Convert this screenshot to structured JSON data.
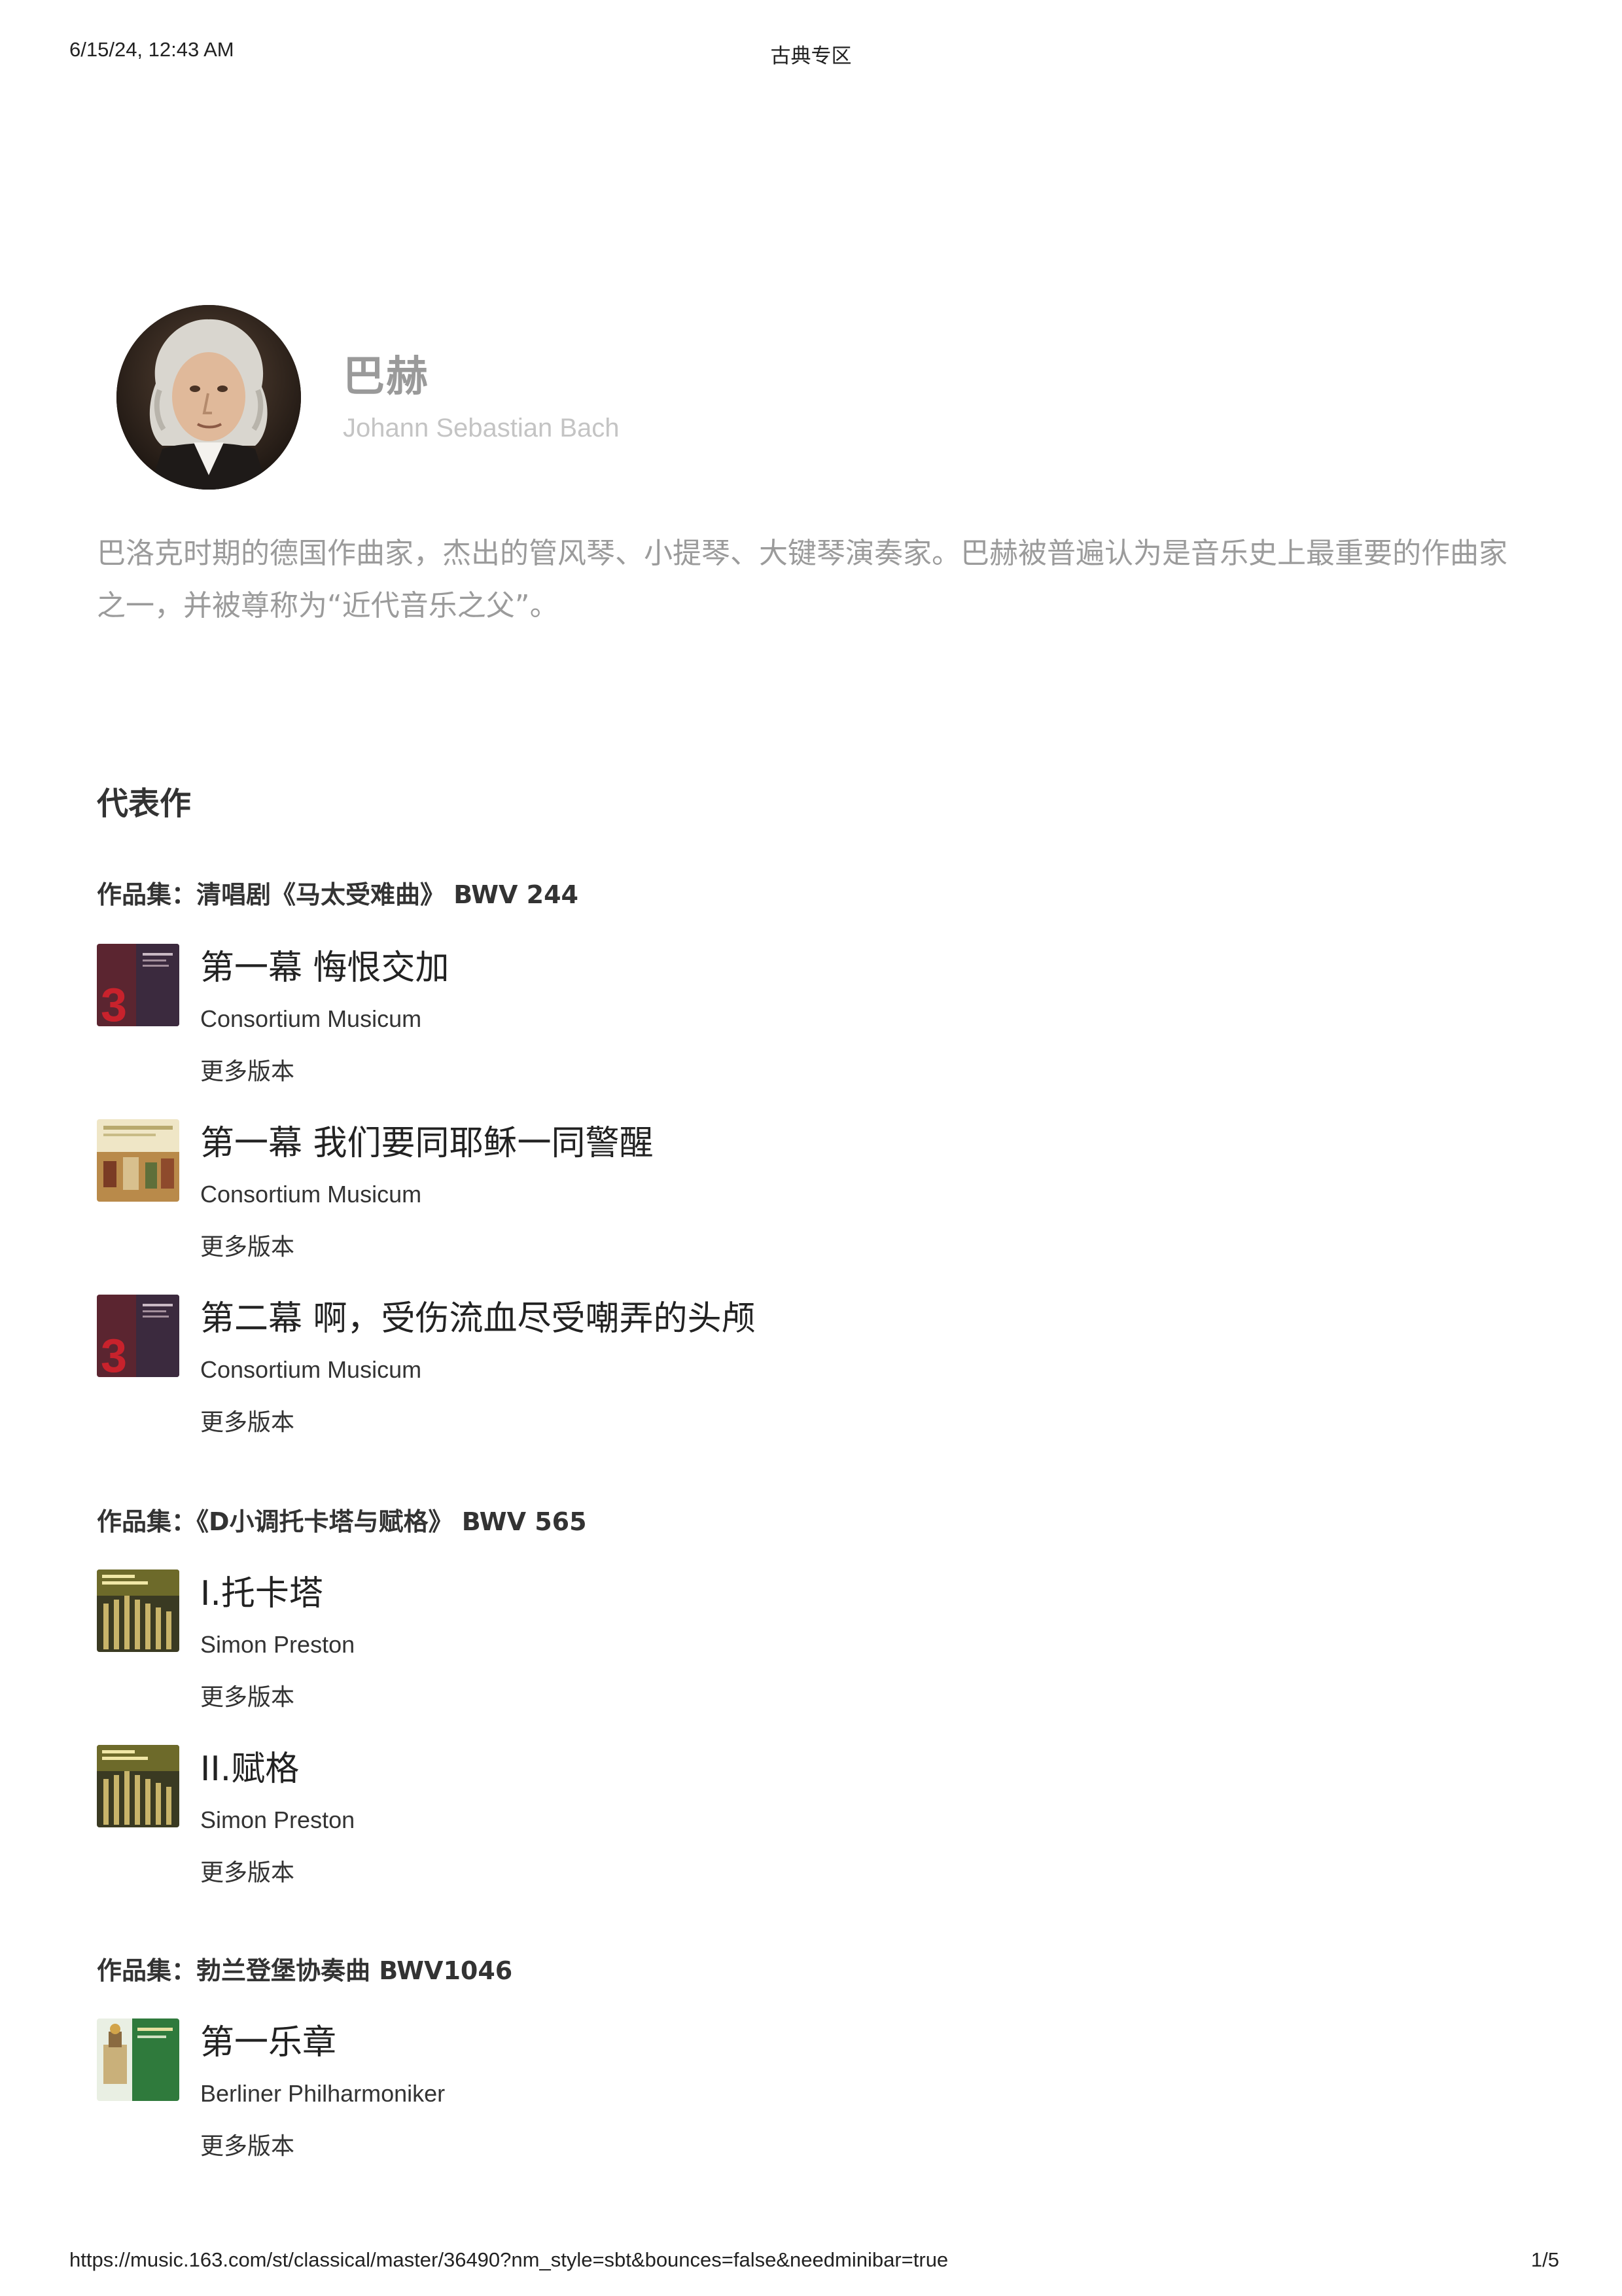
{
  "print_header": {
    "datetime": "6/15/24, 12:43 AM",
    "title": "古典专区"
  },
  "artist": {
    "name": "巴赫",
    "english_name": "Johann Sebastian Bach",
    "description": "巴洛克时期的德国作曲家，杰出的管风琴、小提琴、大键琴演奏家。巴赫被普遍认为是音乐史上最重要的作曲家之一，并被尊称为“近代音乐之父”。"
  },
  "section_title": "代表作",
  "collections": [
    {
      "heading": "作品集：清唱剧《马太受难曲》 BWV 244",
      "tracks": [
        {
          "title": "第一幕 悔恨交加",
          "artist": "Consortium Musicum",
          "more": "更多版本",
          "cover_icon": "album-cover-red"
        },
        {
          "title": "第一幕 我们要同耶稣一同警醒",
          "artist": "Consortium Musicum",
          "more": "更多版本",
          "cover_icon": "album-cover-painting"
        },
        {
          "title": "第二幕 啊，受伤流血尽受嘲弄的头颅",
          "artist": "Consortium Musicum",
          "more": "更多版本",
          "cover_icon": "album-cover-red"
        }
      ]
    },
    {
      "heading": "作品集：《D小调托卡塔与赋格》 BWV 565",
      "tracks": [
        {
          "title": "I.托卡塔",
          "artist": "Simon Preston",
          "more": "更多版本",
          "cover_icon": "album-cover-organ"
        },
        {
          "title": "II.赋格",
          "artist": "Simon Preston",
          "more": "更多版本",
          "cover_icon": "album-cover-organ"
        }
      ]
    },
    {
      "heading": "作品集：勃兰登堡协奏曲 BWV1046",
      "tracks": [
        {
          "title": "第一乐章",
          "artist": "Berliner Philharmoniker",
          "more": "更多版本",
          "cover_icon": "album-cover-green"
        }
      ]
    }
  ],
  "print_footer": {
    "url": "https://music.163.com/st/classical/master/36490?nm_style=sbt&bounces=false&needminibar=true",
    "page": "1/5"
  }
}
